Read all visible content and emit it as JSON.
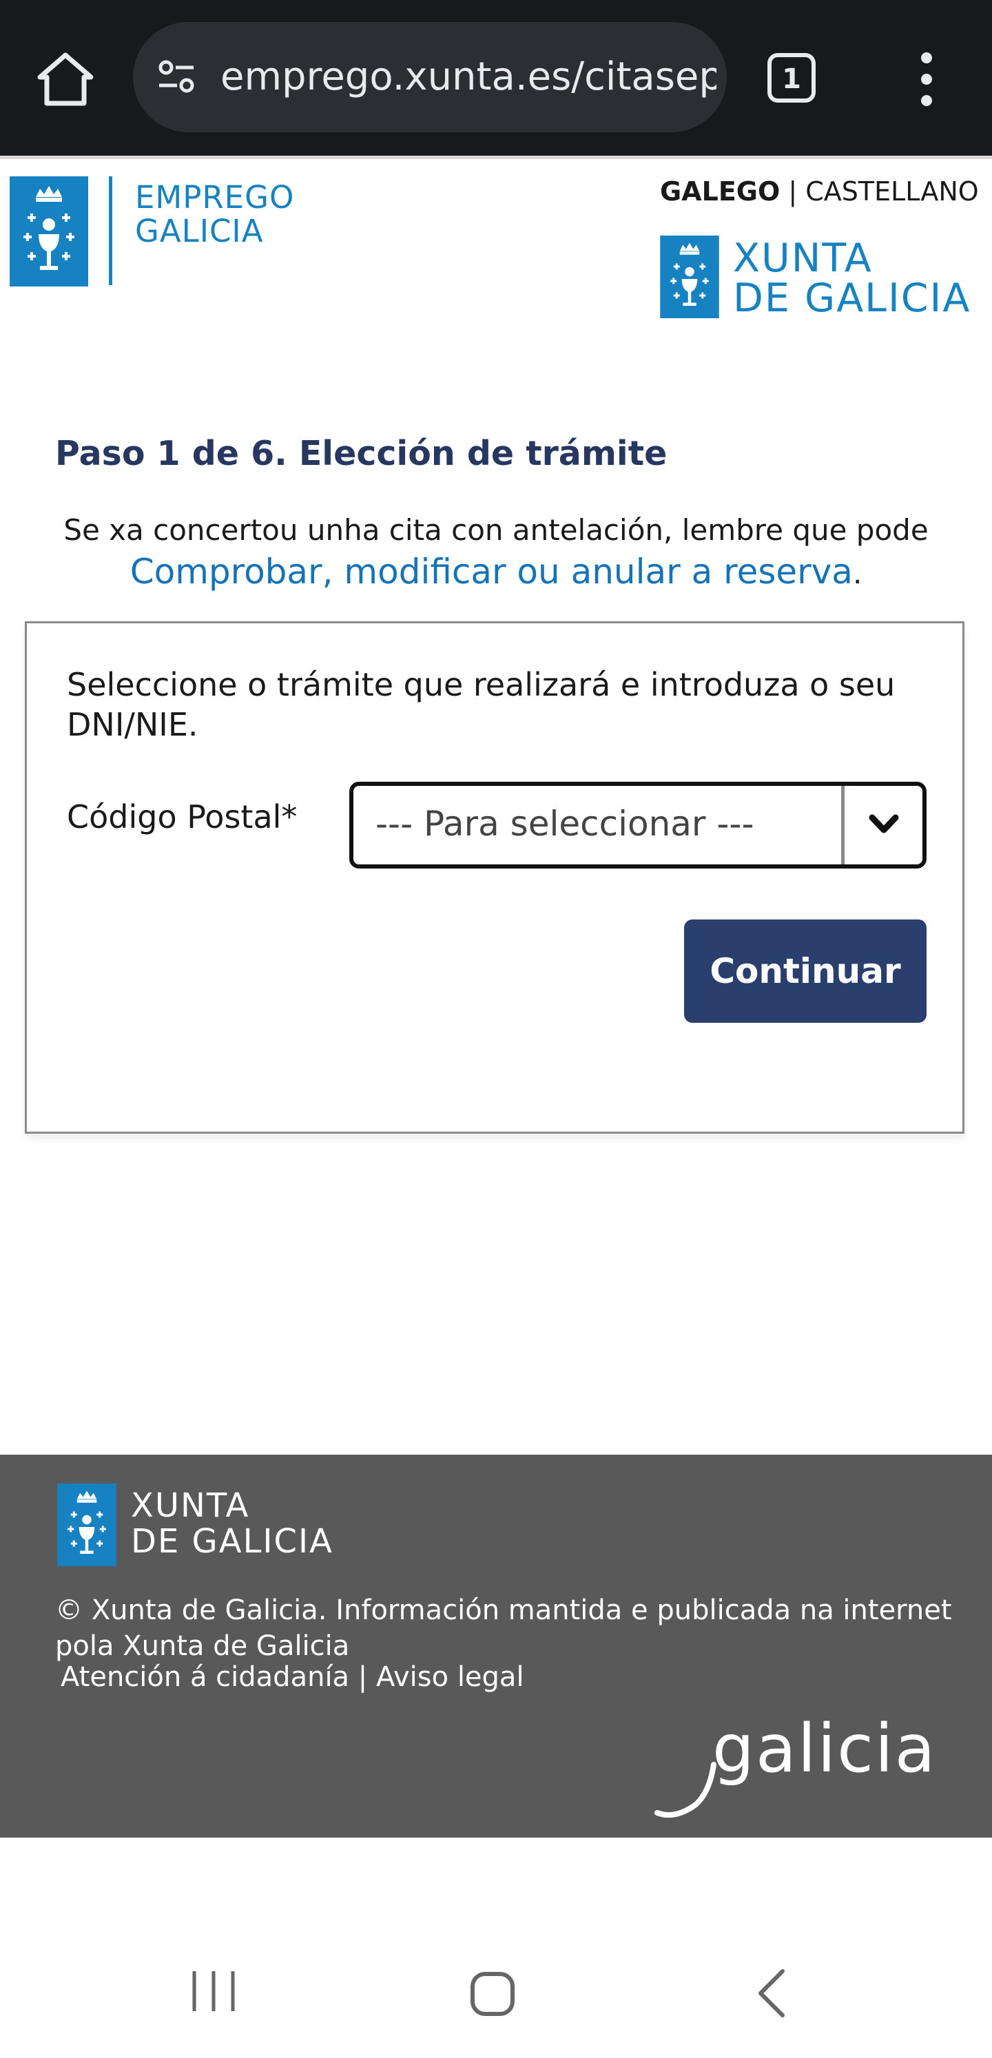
{
  "browser": {
    "url": "emprego.xunta.es/citasepe",
    "tab_count": "1",
    "icons": [
      "home-icon",
      "site-settings-icon",
      "tab-switcher-icon",
      "more-vert-icon"
    ]
  },
  "header": {
    "emprego_line1": "EMPREGO",
    "emprego_line2": "GALICIA",
    "lang_galego": "GALEGO",
    "lang_separator": "|",
    "lang_castellano": "CASTELLANO",
    "xunta_line1": "XUNTA",
    "xunta_line2": "DE GALICIA"
  },
  "main": {
    "step_title": "Paso 1 de 6. Elección de trámite",
    "reminder_text": "Se xa concertou unha cita con antelación, lembre que pode",
    "reservation_link": "Comprobar, modificar ou anular a reserva",
    "reservation_suffix": ".",
    "form": {
      "instructions": "Seleccione o trámite que realizará e introduza o seu DNI/NIE.",
      "postal_label": "Código Postal*",
      "postal_select_value": "--- Para seleccionar ---",
      "continue_label": "Continuar"
    }
  },
  "footer": {
    "xunta_line1": "XUNTA",
    "xunta_line2": "DE GALICIA",
    "copyright": "© Xunta de Galicia. Información mantida e publicada na internet pola Xunta de Galicia",
    "link_attention": "Atención á cidadanía",
    "link_separator": "|",
    "link_legal": "Aviso legal",
    "brand": "galicia"
  },
  "colors": {
    "brand_blue": "#1782c2",
    "title_navy": "#27375f",
    "button_navy": "#2b3f6e",
    "link_blue": "#1673b8",
    "footer_gray": "#595959",
    "chrome_dark": "#17191c"
  }
}
